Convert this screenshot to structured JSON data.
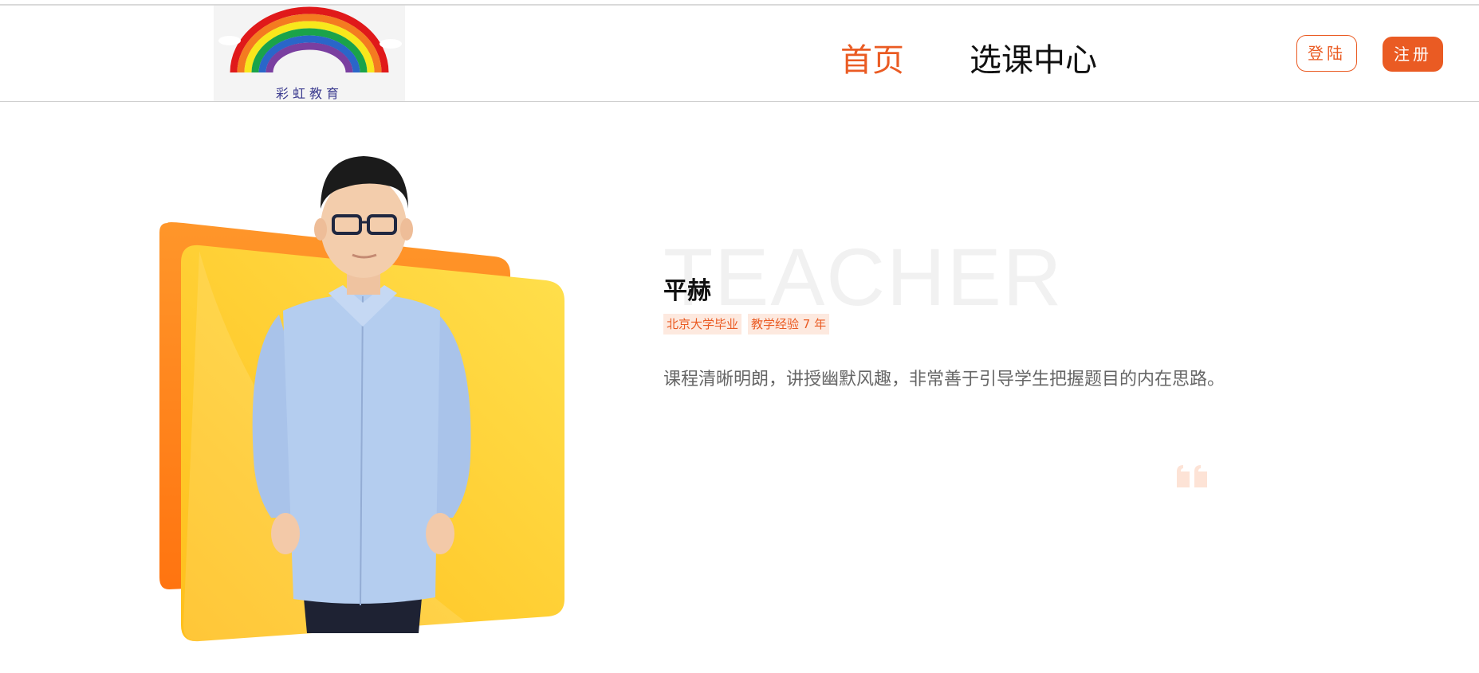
{
  "header": {
    "logo_text": "彩虹教育",
    "nav": [
      {
        "label": "首页",
        "active": true
      },
      {
        "label": "选课中心",
        "active": false
      }
    ],
    "login_label": "登陆",
    "register_label": "注册"
  },
  "teacher": {
    "bg_word": "TEACHER",
    "name": "平赫",
    "tags": [
      "北京大学毕业",
      "教学经验 7 年"
    ],
    "description": "课程清晰明朗，讲授幽默风趣，非常善于引导学生把握题目的内在思路。"
  },
  "colors": {
    "accent": "#ea5b23",
    "card_orange": "#ff8a1f",
    "card_yellow": "#ffd23f",
    "shirt": "#b4cdef",
    "tag_bg": "#fde9df"
  },
  "icons": {
    "quote": "quote-icon"
  }
}
